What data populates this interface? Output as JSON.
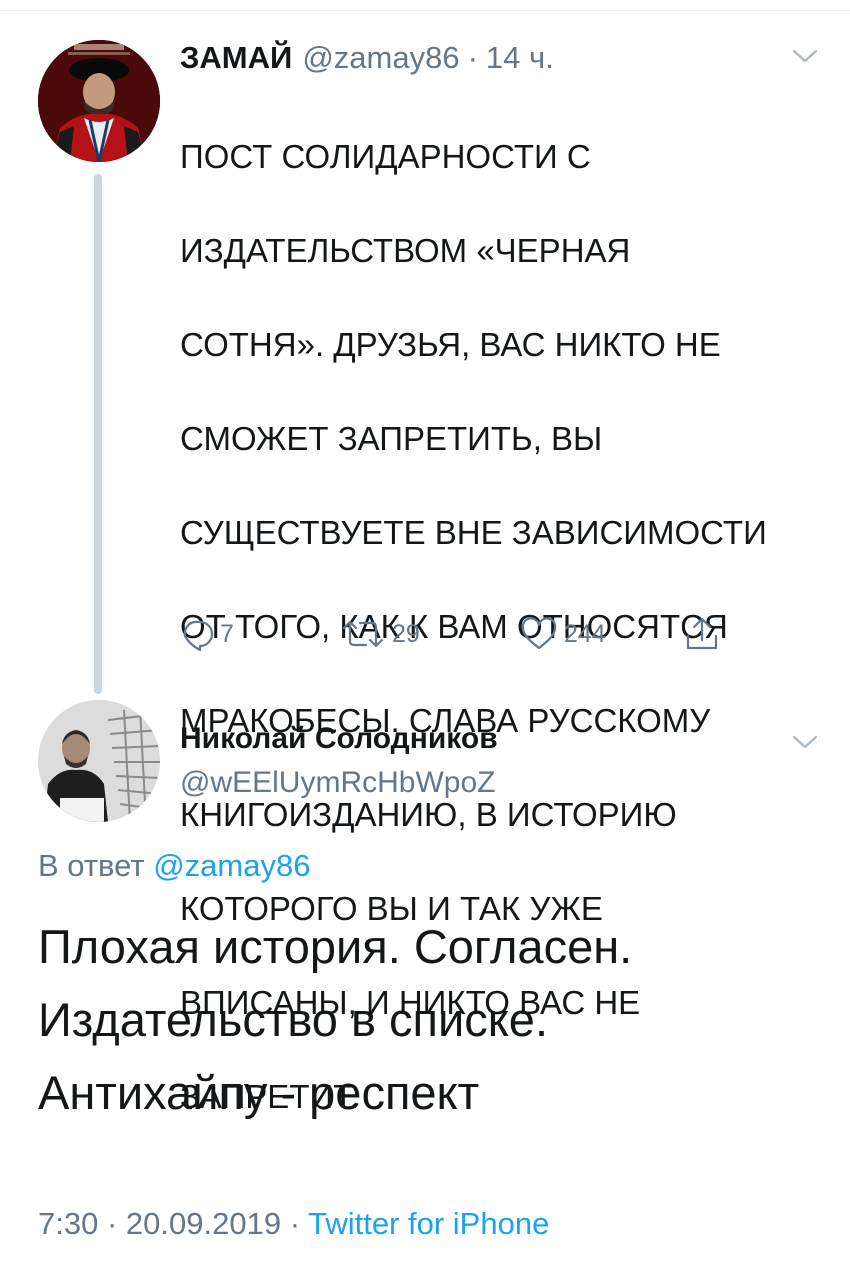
{
  "parent_tweet": {
    "display_name": "ЗАМАЙ",
    "handle": "@zamay86",
    "separator": "·",
    "time": "14 ч.",
    "text_lines": [
      "ПОСТ СОЛИДАРНОСТИ С",
      "ИЗДАТЕЛЬСТВОМ «ЧЕРНАЯ",
      "СОТНЯ». ДРУЗЬЯ, ВАС НИКТО НЕ",
      "СМОЖЕТ ЗАПРЕТИТЬ, ВЫ",
      "СУЩЕСТВУЕТЕ ВНЕ ЗАВИСИМОСТИ",
      "ОТ ТОГО, КАК К ВАМ ОТНОСЯТСЯ",
      "МРАКОБЕСЫ. СЛАВА РУССКОМУ",
      "КНИГОИЗДАНИЮ, В ИСТОРИЮ",
      "КОТОРОГО ВЫ И ТАК УЖЕ",
      "ВПИСАНЫ, И НИКТО ВАС НЕ",
      "ЗАПРЕТИТ."
    ],
    "actions": {
      "reply_count": "7",
      "retweet_count": "29",
      "like_count": "244"
    }
  },
  "reply_tweet": {
    "display_name": "Николай Солодников",
    "handle": "@wEElUymRcHbWpoZ",
    "reply_prefix": "В ответ",
    "reply_mention": "@zamay86",
    "text_lines": [
      "Плохая история. Согласен.",
      "Издательство в списке.",
      "Антихайпу - респект"
    ],
    "time": "7:30",
    "separator_1": "·",
    "date": "20.09.2019",
    "separator_2": "·",
    "source": "Twitter for iPhone"
  },
  "icons": {
    "reply": "reply-bubble-icon",
    "retweet": "retweet-icon",
    "like": "heart-icon",
    "share": "share-icon",
    "menu": "chevron-down-icon"
  },
  "colors": {
    "text": "#14171a",
    "secondary": "#657786",
    "link": "#1da1f2",
    "thread_line": "#ccd6dd"
  }
}
